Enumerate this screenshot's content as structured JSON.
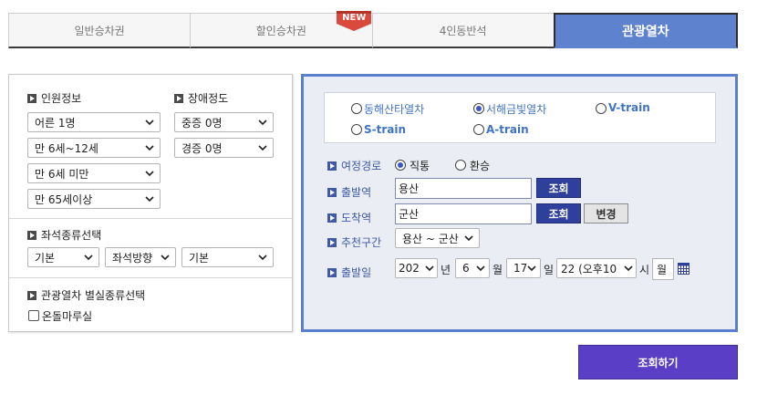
{
  "tabs": [
    {
      "label": "일반승차권"
    },
    {
      "label": "할인승차권",
      "badge": "NEW"
    },
    {
      "label": "4인동반석"
    },
    {
      "label": "관광열차"
    }
  ],
  "passenger": {
    "title": "인원정보",
    "adult": "어른 1명",
    "child": "만 6세~12세",
    "infant": "만 6세 미만",
    "senior": "만 65세이상"
  },
  "disability": {
    "title": "장애정도",
    "severe": "중증 0명",
    "mild": "경증 0명"
  },
  "seat": {
    "title": "좌석종류선택",
    "type": "기본",
    "direction": "좌석방향",
    "position": "기본"
  },
  "room": {
    "title": "관광열차 별실종류선택",
    "ondol_label": "온돌마루실"
  },
  "trains": [
    {
      "label": "동해산타열차",
      "selected": false
    },
    {
      "label": "서해금빛열차",
      "selected": true
    },
    {
      "label": "V-train",
      "selected": false
    },
    {
      "label": "S-train",
      "selected": false
    },
    {
      "label": "A-train",
      "selected": false
    }
  ],
  "route": {
    "label": "여정경로",
    "direct": "직통",
    "transfer": "환승"
  },
  "departure": {
    "label": "출발역",
    "value": "용산",
    "search_button": "조회"
  },
  "arrival": {
    "label": "도착역",
    "value": "군산",
    "search_button": "조회",
    "swap_button": "변경"
  },
  "recommend": {
    "label": "추천구간",
    "value": "용산 ~ 군산"
  },
  "date": {
    "label": "출발일",
    "year": "202",
    "year_unit": "년",
    "month": "6",
    "month_unit": "월",
    "day": "17",
    "day_unit": "일",
    "hour": "22 (오후10",
    "hour_unit": "시",
    "weekday": "월"
  },
  "submit_label": "조회하기",
  "colors": {
    "active_tab": "#5f82cf",
    "panel_border": "#5a7fcc",
    "navy_button": "#2e3f9c",
    "submit": "#5a3fc6",
    "new_badge": "#d9493c"
  }
}
